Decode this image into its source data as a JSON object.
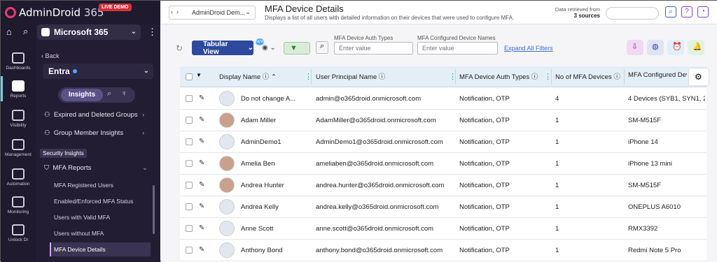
{
  "app": {
    "name_a": "AdminDroid",
    "name_b": " 365",
    "badge": "LIVE DEMO"
  },
  "tenant": {
    "label": "Microsoft 365"
  },
  "rail": [
    {
      "label": "Dashboards"
    },
    {
      "label": "Reports"
    },
    {
      "label": "Visibility"
    },
    {
      "label": "Management"
    },
    {
      "label": "Automation"
    },
    {
      "label": "Monitoring"
    },
    {
      "label": "Unlock DI"
    }
  ],
  "sidebar": {
    "back": "Back",
    "product": "Entra",
    "insights": "Insights",
    "items": [
      {
        "label": "Expired and Deleted Groups"
      },
      {
        "label": "Group Member Insights"
      }
    ],
    "section": "Security Insights",
    "group": "MFA Reports",
    "sub": [
      {
        "label": "MFA Registered Users"
      },
      {
        "label": "Enabled/Enforced MFA Status"
      },
      {
        "label": "Users with Valid MFA"
      },
      {
        "label": "Users without MFA"
      },
      {
        "label": "MFA Device Details"
      }
    ]
  },
  "header": {
    "breadcrumb": "AdminDroid Dem...",
    "title": "MFA Device Details",
    "desc": "Displays a list of all users with detailed information on their devices that were used to configure MFA.",
    "source_line1": "Data retrieved from",
    "source_line2": "3 sources"
  },
  "toolbar": {
    "view": "Tabular View",
    "new_badge": "NEW",
    "filter1_label": "MFA Device Auth Types",
    "filter1_placeholder": "Enter value",
    "filter2_label": "MFA Configured Device Names",
    "filter2_placeholder": "Enter value",
    "expand": "Expand All Filters"
  },
  "table": {
    "columns": [
      "Display Name",
      "User Principal Name",
      "MFA Device Auth Types",
      "No of MFA Devices",
      "MFA Configured Dev"
    ],
    "rows": [
      {
        "name": "Do not change A...",
        "upn": "admin@o365droid.onmicrosoft.com",
        "auth": "Notification, OTP",
        "count": "4",
        "device": "4 Devices (SYB1, SYN1, 2"
      },
      {
        "name": "Adam Miller",
        "upn": "AdamMiller@o365droid.onmicrosoft.com",
        "auth": "Notification, OTP",
        "count": "1",
        "device": "SM-M515F"
      },
      {
        "name": "AdminDemo1",
        "upn": "AdminDemo1@o365droid.onmicrosoft.com",
        "auth": "Notification, OTP",
        "count": "1",
        "device": "iPhone 14"
      },
      {
        "name": "Amelia Ben",
        "upn": "ameliaben@o365droid.onmicrosoft.com",
        "auth": "Notification, OTP",
        "count": "1",
        "device": "iPhone 13 mini"
      },
      {
        "name": "Andrea Hunter",
        "upn": "andrea.hunter@o365droid.onmicrosoft.com",
        "auth": "Notification, OTP",
        "count": "1",
        "device": "SM-M515F"
      },
      {
        "name": "Andrea Kelly",
        "upn": "andrea.kelly@o365droid.onmicrosoft.com",
        "auth": "Notification, OTP",
        "count": "1",
        "device": "ONEPLUS A6010"
      },
      {
        "name": "Anne Scott",
        "upn": "anne.scott@o365droid.onmicrosoft.com",
        "auth": "Notification, OTP",
        "count": "1",
        "device": "RMX3392"
      },
      {
        "name": "Anthony Bond",
        "upn": "anthony.bond@o365droid.onmicrosoft.com",
        "auth": "Notification, OTP",
        "count": "1",
        "device": "Redmi Note 5 Pro"
      }
    ]
  }
}
